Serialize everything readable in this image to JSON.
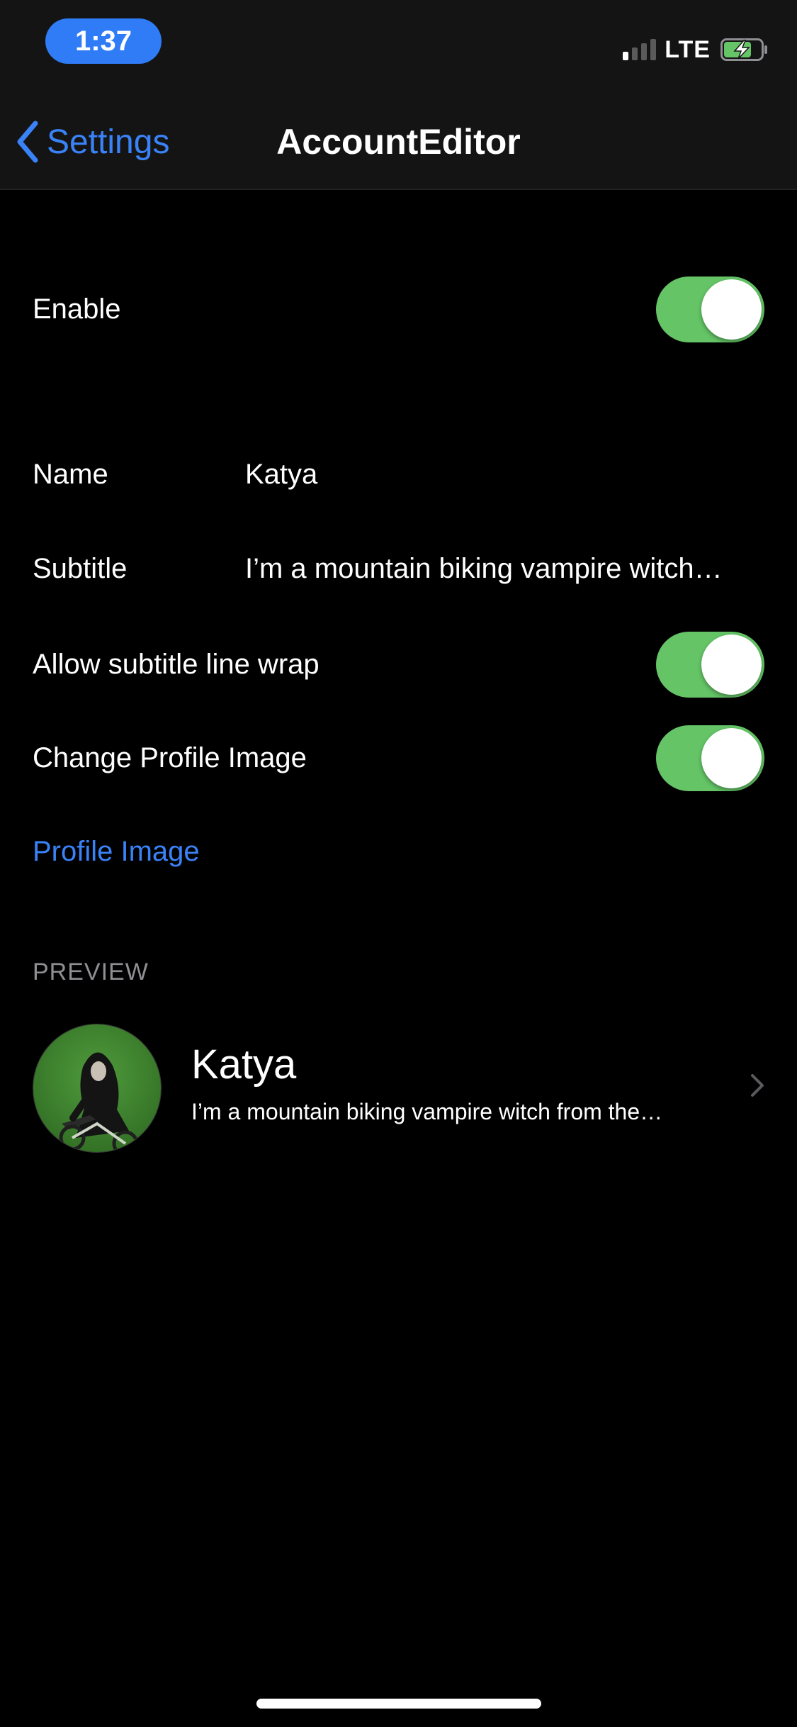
{
  "status_bar": {
    "time": "1:37",
    "network": "LTE",
    "icons": [
      "signal-icon",
      "battery-charging-icon"
    ],
    "signal_bars_active": 1,
    "signal_bars_total": 4,
    "colors": {
      "time_pill": "#2f7cf6",
      "battery_fill": "#64c466"
    }
  },
  "nav": {
    "back_label": "Settings",
    "back_icon": "chevron-left-icon",
    "title": "AccountEditor",
    "accent_color": "#3a82f7"
  },
  "settings": {
    "enable": {
      "label": "Enable",
      "on": true
    },
    "name": {
      "label": "Name",
      "value": "Katya"
    },
    "subtitle": {
      "label": "Subtitle",
      "value": "I’m a mountain biking vampire witch…"
    },
    "allow_wrap": {
      "label": "Allow subtitle line wrap",
      "on": true
    },
    "change_image": {
      "label": "Change Profile Image",
      "on": true
    },
    "profile_image_link": "Profile Image"
  },
  "preview": {
    "header": "PREVIEW",
    "name": "Katya",
    "subtitle": "I’m a mountain biking vampire witch from the…",
    "avatar_icon": "profile-avatar-image",
    "chevron_icon": "chevron-right-icon"
  },
  "toggle_color": "#64c466"
}
